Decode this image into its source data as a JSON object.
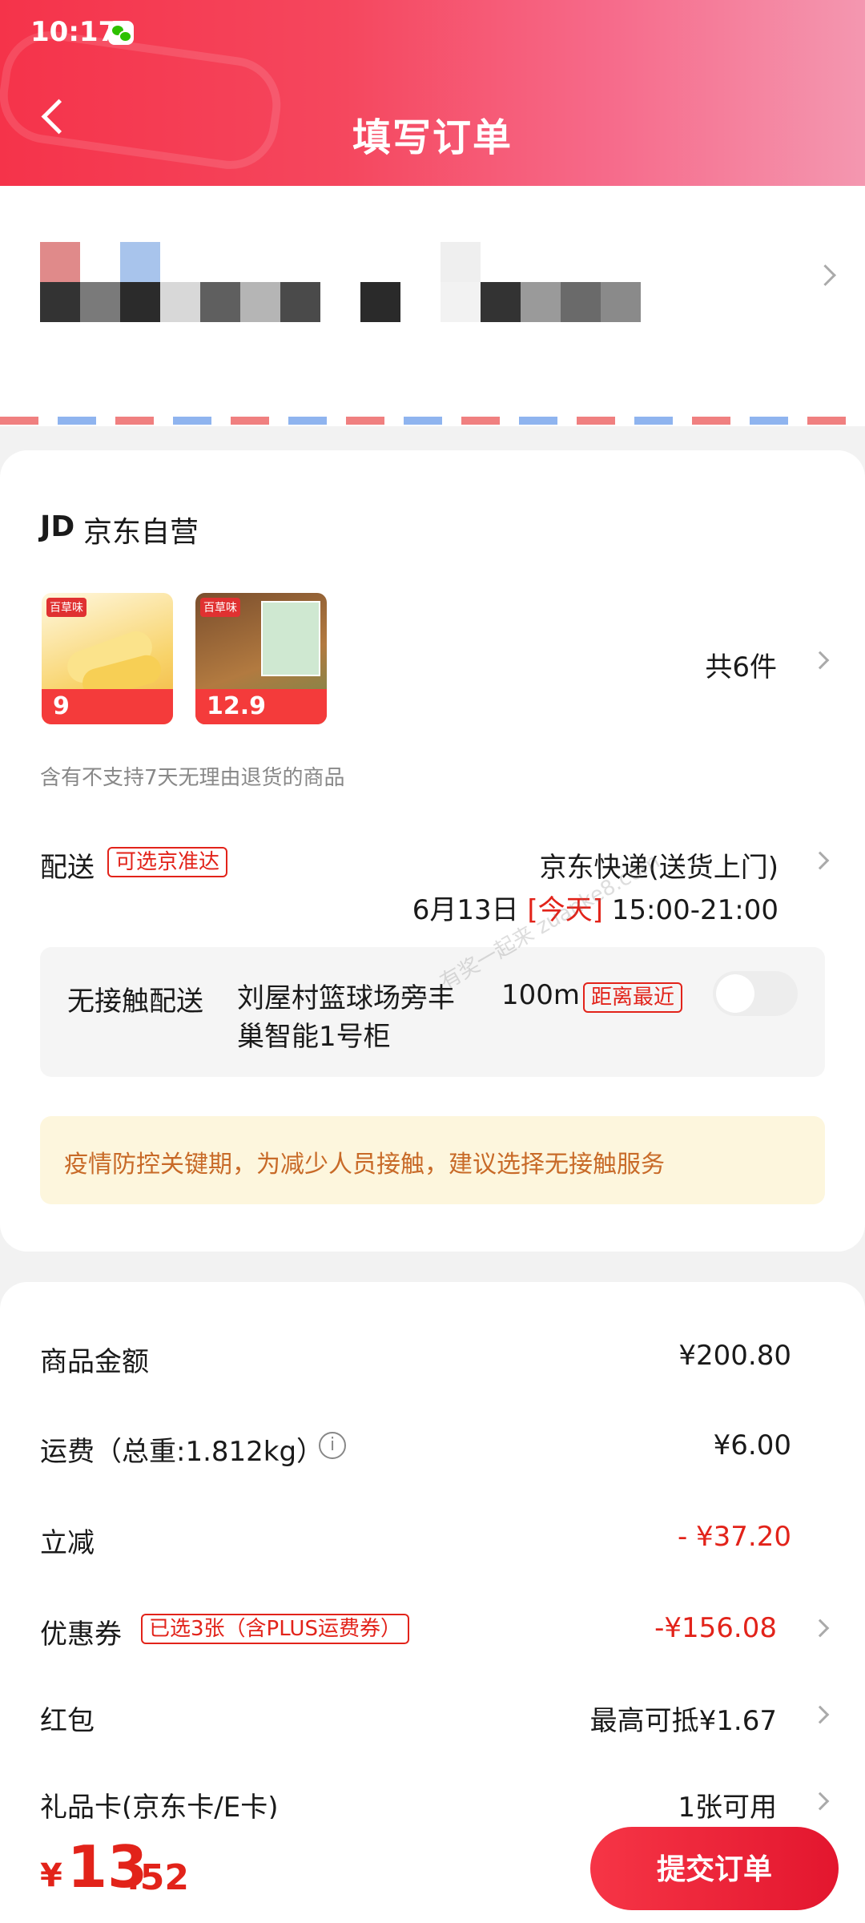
{
  "status_bar": {
    "time": "10:17"
  },
  "header": {
    "title": "填写订单"
  },
  "store": {
    "logo": "JD",
    "name": "京东自营",
    "item_count": "共6件",
    "thumbs": [
      {
        "price": "9"
      },
      {
        "price": "12.9"
      }
    ]
  },
  "return_note": "含有不支持7天无理由退货的商品",
  "shipping": {
    "label": "配送",
    "badge": "可选京准达",
    "method": "京东快递(送货上门)",
    "date": "6月13日",
    "today": "[今天]",
    "time_window": "15:00-21:00"
  },
  "contactless": {
    "title": "无接触配送",
    "address": "刘屋村篮球场旁丰巢智能1号柜",
    "distance": "100m",
    "badge": "距离最近"
  },
  "notice": "疫情防控关键期，为减少人员接触，建议选择无接触服务",
  "summary": {
    "goods_label": "商品金额",
    "goods_value": "¥200.80",
    "freight_label": "运费（总重:1.812kg）",
    "freight_value": "¥6.00",
    "discount_label": "立减",
    "discount_value": "- ¥37.20",
    "coupon_label": "优惠券",
    "coupon_badge": "已选3张（含PLUS运费券）",
    "coupon_value": "-¥156.08",
    "redpacket_label": "红包",
    "redpacket_value": "最高可抵¥1.67",
    "giftcard_label": "礼品卡(京东卡/E卡)",
    "giftcard_value": "1张可用"
  },
  "bottom": {
    "currency": "¥",
    "total_int": "13",
    "total_dec": ".52",
    "submit_label": "提交订单"
  },
  "watermark": "有奖一起来 zuanke8.com",
  "colors": {
    "accent": "#e2231a",
    "header_start": "#f5334a",
    "header_end": "#f497b0"
  }
}
